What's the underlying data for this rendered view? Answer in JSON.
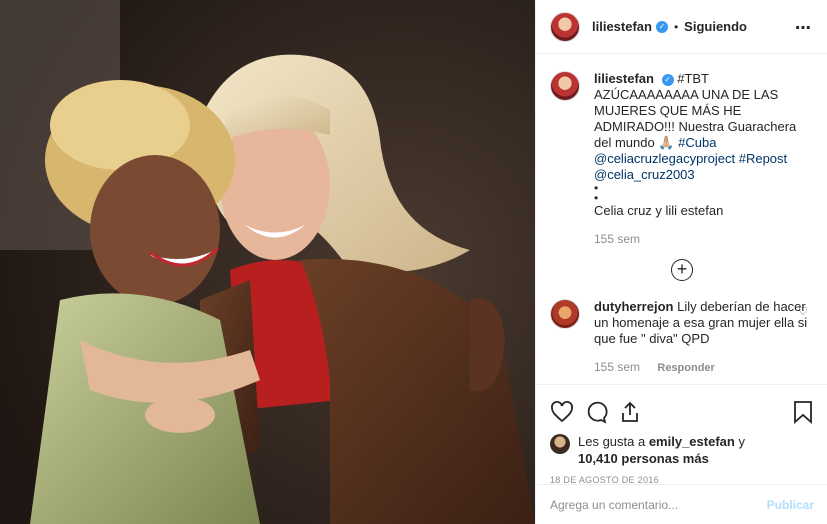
{
  "header": {
    "username": "liliestefan",
    "verified_mark": "✓",
    "separator": "•",
    "follow_label": "Siguiendo",
    "more_icon": "⋯"
  },
  "caption": {
    "username": "liliestefan",
    "text_1": "#TBT AZÚCAAAAAAAA UNA DE LAS MUJERES QUE MÁS HE ADMIRADO!!! Nuestra Guarachera del mundo 🙏🏼 ",
    "tag_cuba": "#Cuba",
    "tag_legacy": "@celiacruzlegacyproject",
    "tag_repost": "#Repost",
    "tag_celia": "@celia_cruz2003",
    "dots": "•\n•",
    "names": "Celia cruz y lili estefan",
    "time": "155 sem"
  },
  "load_more_icon": "+",
  "comment": {
    "username": "dutyherrejon",
    "text": "Lily deberían de hacer un homenaje a esa gran mujer ella si que fue \" diva\" QPD",
    "time": "155 sem",
    "reply_label": "Responder",
    "like_icon": "♡"
  },
  "likes": {
    "prefix": "Les gusta a ",
    "user": "emily_estefan",
    "conj": " y",
    "count": "10,410 personas más"
  },
  "date": "18 DE AGOSTO DE 2016",
  "add_comment": {
    "placeholder": "Agrega un comentario...",
    "publish_label": "Publicar"
  }
}
